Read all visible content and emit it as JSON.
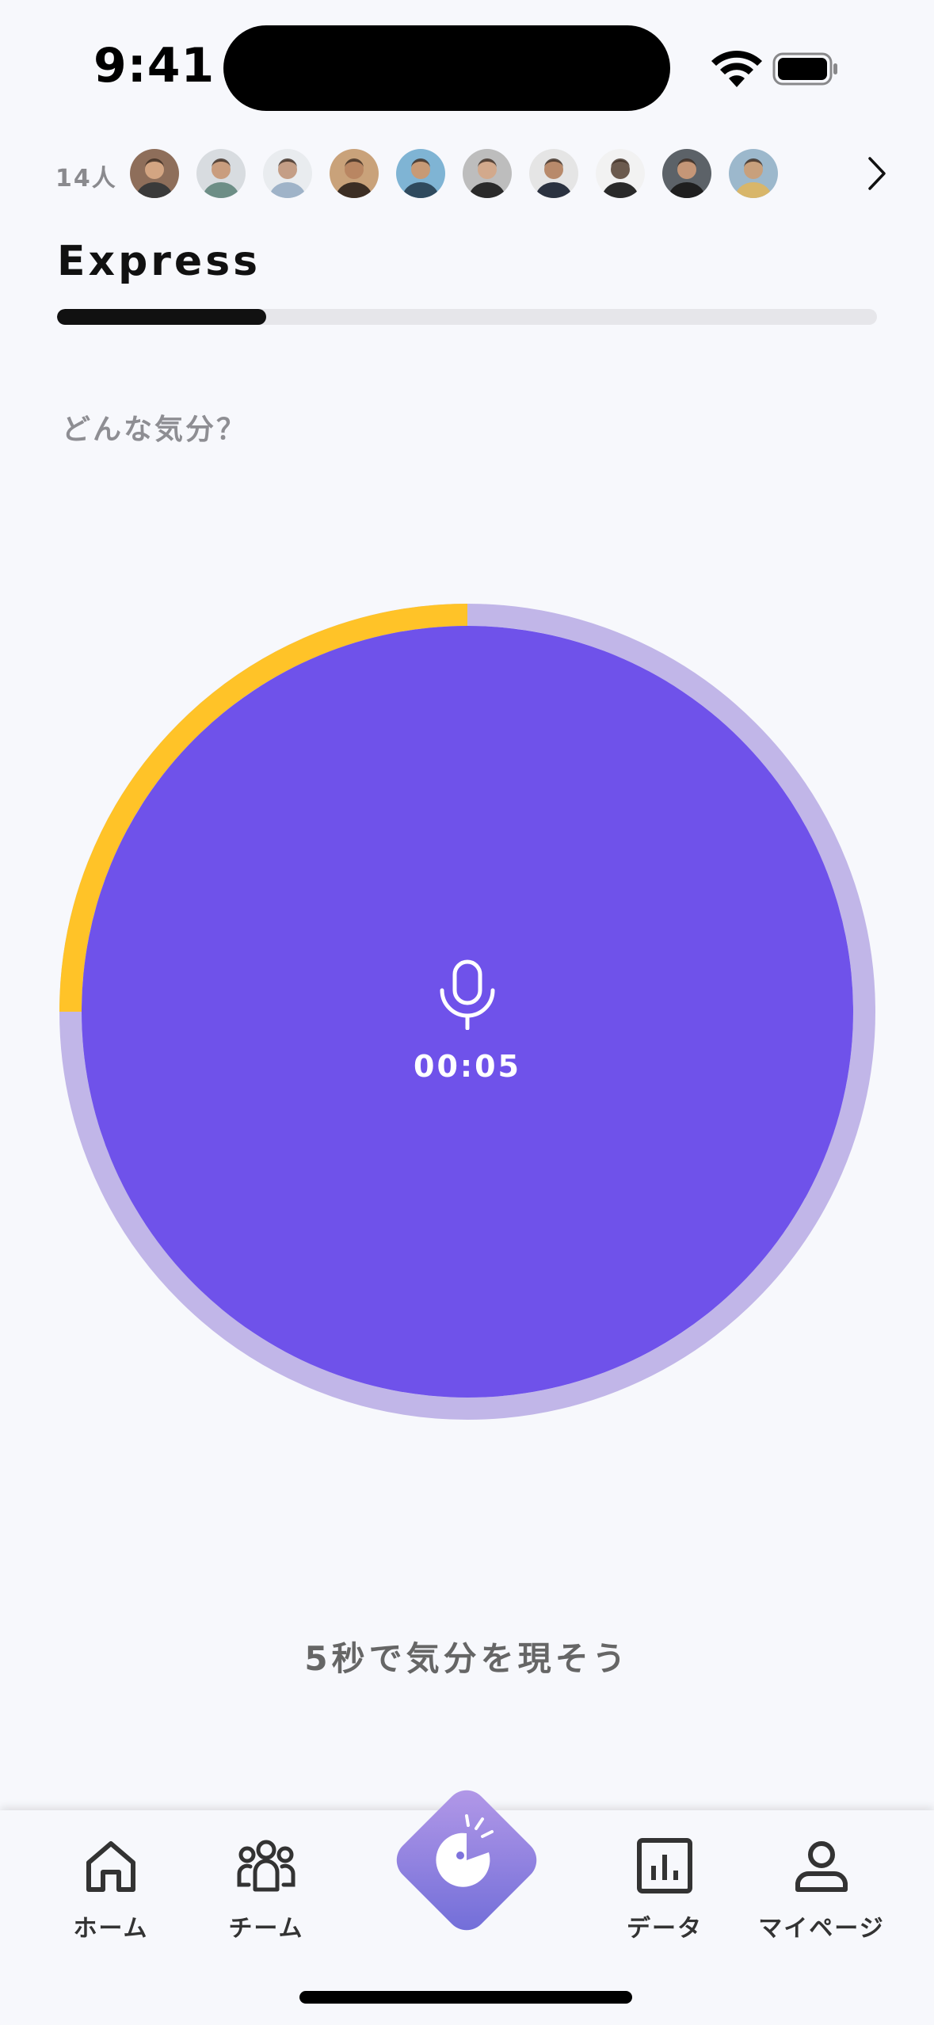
{
  "status_bar": {
    "time": "9:41"
  },
  "members": {
    "count_label": "14人",
    "avatars": [
      {
        "name": "member-1",
        "bg": "#8E6E5A",
        "skin": "#D3A582",
        "shirt": "#3A3A3A"
      },
      {
        "name": "member-2",
        "bg": "#D8DCE0",
        "skin": "#C99D7E",
        "shirt": "#6D8E86"
      },
      {
        "name": "member-3",
        "bg": "#E9ECEF",
        "skin": "#C49E86",
        "shirt": "#9FB3C8"
      },
      {
        "name": "member-4",
        "bg": "#C9A27A",
        "skin": "#B98662",
        "shirt": "#3C2E24"
      },
      {
        "name": "member-5",
        "bg": "#7FB4D4",
        "skin": "#C79A76",
        "shirt": "#2F4A5E"
      },
      {
        "name": "member-6",
        "bg": "#BDBDBD",
        "skin": "#D2A98C",
        "shirt": "#2A2A2A"
      },
      {
        "name": "member-7",
        "bg": "#E5E5E5",
        "skin": "#B88A6B",
        "shirt": "#2B3240"
      },
      {
        "name": "member-8",
        "bg": "#F2F2F2",
        "skin": "#6B5A4E",
        "shirt": "#2A2A2A"
      },
      {
        "name": "member-9",
        "bg": "#5C6268",
        "skin": "#C59677",
        "shirt": "#1F1F1F"
      },
      {
        "name": "member-10",
        "bg": "#9CB8CC",
        "skin": "#C8A07C",
        "shirt": "#D8B66A"
      }
    ]
  },
  "page": {
    "title": "Express",
    "progress_percent": 25.5,
    "prompt": "どんな気分？",
    "timer": "00:05",
    "instruction": "5秒で気分を現そう"
  },
  "record": {
    "elapsed_fraction": 0.25,
    "colors": {
      "main": "#6F52EA",
      "track": "#C1B6E8",
      "elapsed": "#FFC328"
    }
  },
  "tabbar": {
    "home": "ホーム",
    "team": "チーム",
    "data": "データ",
    "mypage": "マイページ"
  }
}
